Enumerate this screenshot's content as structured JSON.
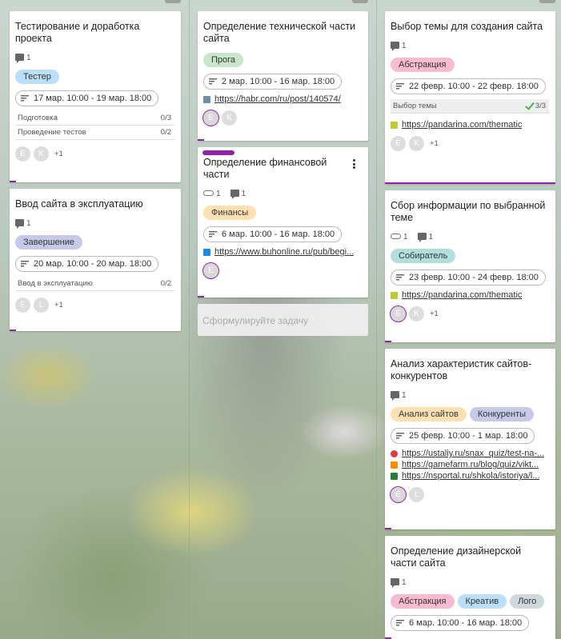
{
  "colors": {
    "accent": "#8e24aa",
    "tag_blue": "#bbdefb",
    "tag_purple": "#c5cae9",
    "tag_green": "#c8e6c9",
    "tag_orange": "#ffe0b2",
    "tag_pink": "#f8bbd0",
    "tag_teal": "#b2dfdb",
    "tag_grey": "#cfd8dc"
  },
  "columns": [
    {
      "cards": [
        {
          "title": "Тестирование и доработка проекта",
          "comments": "1",
          "tags": [
            "Тестер"
          ],
          "date": "17 мар. 10:00 - 19 мар. 18:00",
          "checklists": [
            {
              "name": "Подготовка",
              "count": "0/3"
            },
            {
              "name": "Проведение тестов",
              "count": "0/2"
            }
          ],
          "avatars": [
            "E",
            "K"
          ],
          "more": "+1"
        },
        {
          "title": "Ввод сайта в эксплуатацию",
          "comments": "1",
          "tags": [
            "Завершение"
          ],
          "date": "20 мар. 10:00 - 20 мар. 18:00",
          "checklists": [
            {
              "name": "Ввод в эксплуатацию",
              "count": "0/2"
            }
          ],
          "avatars": [
            "E",
            "L"
          ],
          "more": "+1"
        }
      ]
    },
    {
      "cards": [
        {
          "title": "Определение технической части сайта",
          "tags": [
            "Прога"
          ],
          "date": "2 мар. 10:00 - 16 мар. 18:00",
          "links": [
            {
              "url": "https://habr.com/ru/post/140574/",
              "icon": "habr-icon"
            }
          ],
          "avatars": [
            "E",
            "K"
          ]
        },
        {
          "title": "Определение финансовой части",
          "attachments": "1",
          "comments": "1",
          "tags": [
            "Финансы"
          ],
          "date": "6 мар. 10:00 - 16 мар. 18:00",
          "links": [
            {
              "url": "https://www.buhonline.ru/pub/begi...",
              "icon": "buhonline-icon"
            }
          ],
          "avatars": [
            "E"
          ]
        }
      ],
      "new_task_placeholder": "Сформулируйте задачу"
    },
    {
      "cards": [
        {
          "title": "Выбор темы для создания сайта",
          "comments": "1",
          "tags": [
            "Абстракция"
          ],
          "date": "22 февр. 10:00 - 22 февр. 18:00",
          "checklists": [
            {
              "name": "Выбор темы",
              "count": "3/3"
            }
          ],
          "links": [
            {
              "url": "https://pandarina.com/thematic",
              "icon": "pandarina-icon"
            }
          ],
          "avatars": [
            "E",
            "K"
          ],
          "more": "+1"
        },
        {
          "title": "Сбор информации по выбранной теме",
          "attachments": "1",
          "comments": "1",
          "tags": [
            "Собиратель"
          ],
          "date": "23 февр. 10:00 - 24 февр. 18:00",
          "links": [
            {
              "url": "https://pandarina.com/thematic",
              "icon": "pandarina-icon"
            }
          ],
          "avatars": [
            "E",
            "K"
          ],
          "more": "+1"
        },
        {
          "title": "Анализ характеристик сайтов-конкурентов",
          "comments": "1",
          "tags": [
            "Анализ сайтов",
            "Конкуренты"
          ],
          "date": "25 февр. 10:00 - 1 мар. 18:00",
          "links": [
            {
              "url": "https://ustaliy.ru/snax_quiz/test-na-...",
              "icon": "ustaliy-icon"
            },
            {
              "url": "https://gamefarm.ru/blog/quiz/vikt...",
              "icon": "gamefarm-icon"
            },
            {
              "url": "https://nsportal.ru/shkola/istoriya/l...",
              "icon": "nsportal-icon"
            }
          ],
          "avatars": [
            "E",
            "L"
          ]
        },
        {
          "title": "Определение дизайнерской части сайта",
          "comments": "1",
          "tags": [
            "Абстракция",
            "Креатив",
            "Лого"
          ],
          "date": "6 мар. 10:00 - 16 мар. 18:00"
        }
      ]
    }
  ]
}
